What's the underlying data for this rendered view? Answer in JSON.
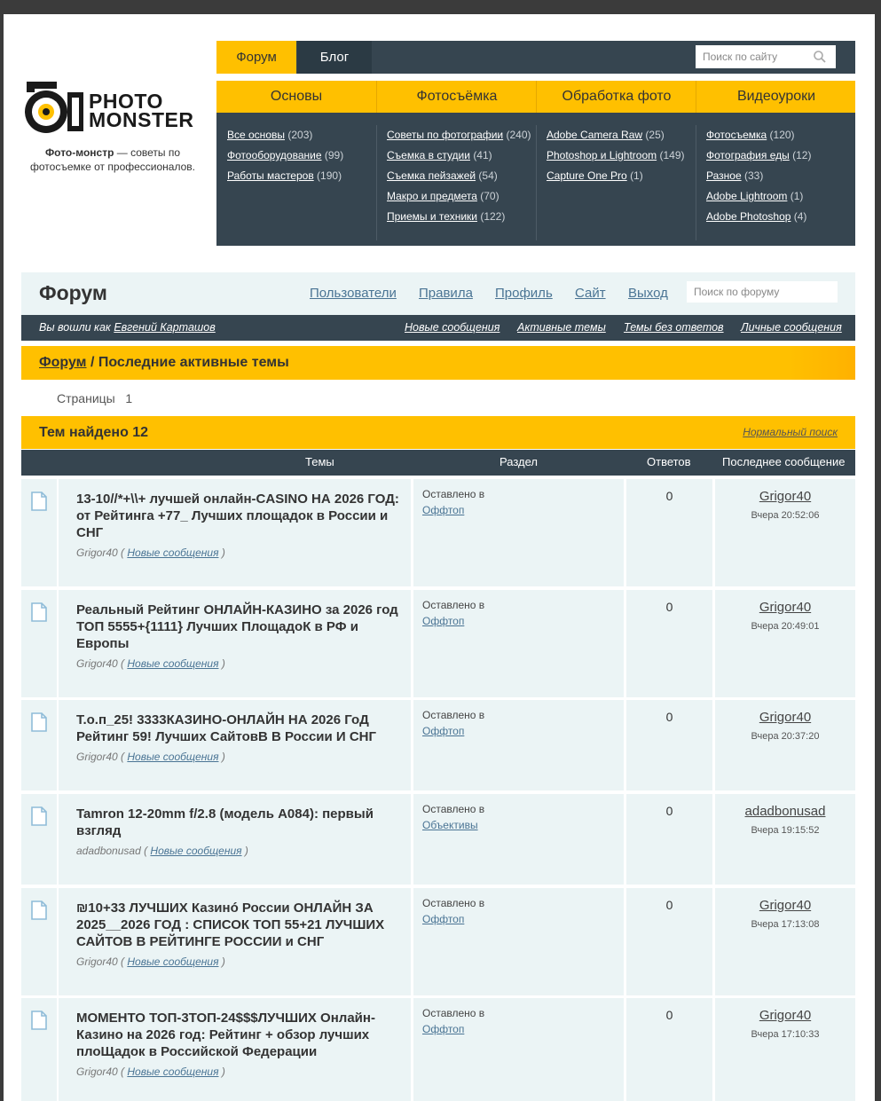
{
  "logo": {
    "line1": "PHOTO",
    "line2": "MONSTER"
  },
  "tagline": {
    "bold": "Фото-монстр",
    "rest": " — советы по фотосъемке от профессионалов."
  },
  "topnav": {
    "forum": "Форум",
    "blog": "Блог",
    "search_placeholder": "Поиск по сайту"
  },
  "categories": [
    {
      "title": "Основы",
      "links": [
        {
          "label": "Все основы",
          "count": "(203)"
        },
        {
          "label": "Фотооборудование",
          "count": "(99)"
        },
        {
          "label": "Работы мастеров",
          "count": "(190)"
        }
      ]
    },
    {
      "title": "Фотосъёмка",
      "links": [
        {
          "label": "Советы по фотографии",
          "count": "(240)"
        },
        {
          "label": "Съемка в студии",
          "count": "(41)"
        },
        {
          "label": "Съемка пейзажей",
          "count": "(54)"
        },
        {
          "label": "Макро и предмета",
          "count": "(70)"
        },
        {
          "label": "Приемы и техники",
          "count": "(122)"
        }
      ]
    },
    {
      "title": "Обработка фото",
      "links": [
        {
          "label": "Adobe Camera Raw",
          "count": "(25)"
        },
        {
          "label": "Photoshop и Lightroom",
          "count": "(149)"
        },
        {
          "label": "Capture One Pro",
          "count": "(1)"
        }
      ]
    },
    {
      "title": "Видеоуроки",
      "links": [
        {
          "label": "Фотосъемка",
          "count": "(120)"
        },
        {
          "label": "Фотография еды",
          "count": "(12)"
        },
        {
          "label": "Разное",
          "count": "(33)"
        },
        {
          "label": "Adobe Lightroom",
          "count": "(1)"
        },
        {
          "label": "Adobe Photoshop",
          "count": "(4)"
        }
      ]
    }
  ],
  "forum": {
    "title": "Форум",
    "nav": [
      "Пользователи",
      "Правила",
      "Профиль",
      "Сайт",
      "Выход"
    ],
    "search_placeholder": "Поиск по форуму",
    "logged_as": "Вы вошли как",
    "user": "Евгений Карташов",
    "links": [
      "Новые сообщения",
      "Активные темы",
      "Темы без ответов",
      "Личные сообщения"
    ],
    "crumb_root": "Форум",
    "crumb_current": "/ Последние активные темы",
    "pages_label": "Страницы",
    "pages_value": "1",
    "found": "Тем найдено 12",
    "normal_search": "Нормальный поиск",
    "columns": [
      "Темы",
      "Раздел",
      "Ответов",
      "Последнее сообщение"
    ],
    "posted_in": "Оставлено в",
    "new_msgs": "Новые сообщения"
  },
  "topics": [
    {
      "title": "13-10//*+\\\\+ лучшей онлайн-CASINO НА 2026 ГОД: от Рейтинга +77_ Лучших площадок в России и СНГ",
      "author": "Grigor40",
      "section": "Оффтоп",
      "replies": "0",
      "last_user": "Grigor40",
      "last_time": "Вчера 20:52:06"
    },
    {
      "title": "Реальный Рейтинг ОНЛАЙН-КАЗИНО за 2026 год ТОП 5555+{1111} Лучших ПлощадоК в РФ и Европы",
      "author": "Grigor40",
      "section": "Оффтоп",
      "replies": "0",
      "last_user": "Grigor40",
      "last_time": "Вчера 20:49:01"
    },
    {
      "title": "Т.о.п_25! 3333КАЗИНО-ОНЛАЙН НА 2026 ГоД Рейтинг 59! Лучших СайтовВ В России И СНГ",
      "author": "Grigor40",
      "section": "Оффтоп",
      "replies": "0",
      "last_user": "Grigor40",
      "last_time": "Вчера 20:37:20"
    },
    {
      "title": "Tamron 12-20mm f/2.8 (модель A084): первый взгляд",
      "author": "adadbonusad",
      "section": "Объективы",
      "replies": "0",
      "last_user": "adadbonusad",
      "last_time": "Вчера 19:15:52"
    },
    {
      "title": "₪10+33 ЛУЧШИХ Казинó России ОНЛАЙН ЗА 2025__2026 ГОД : СПИСОК ТОП 55+21 ЛУЧШИХ САЙТОВ В РЕЙТИНГЕ РОССИИ и СНГ",
      "author": "Grigor40",
      "section": "Оффтоп",
      "replies": "0",
      "last_user": "Grigor40",
      "last_time": "Вчера 17:13:08"
    },
    {
      "title": "МОМЕНТО ТОП-3ТОП-24$$$ЛУЧШИХ Онлайн-Казино на 2026 год: Рейтинг + обзор лучших плоЩадок в Российской Федерации",
      "author": "Grigor40",
      "section": "Оффтоп",
      "replies": "0",
      "last_user": "Grigor40",
      "last_time": "Вчера 17:10:33"
    }
  ]
}
